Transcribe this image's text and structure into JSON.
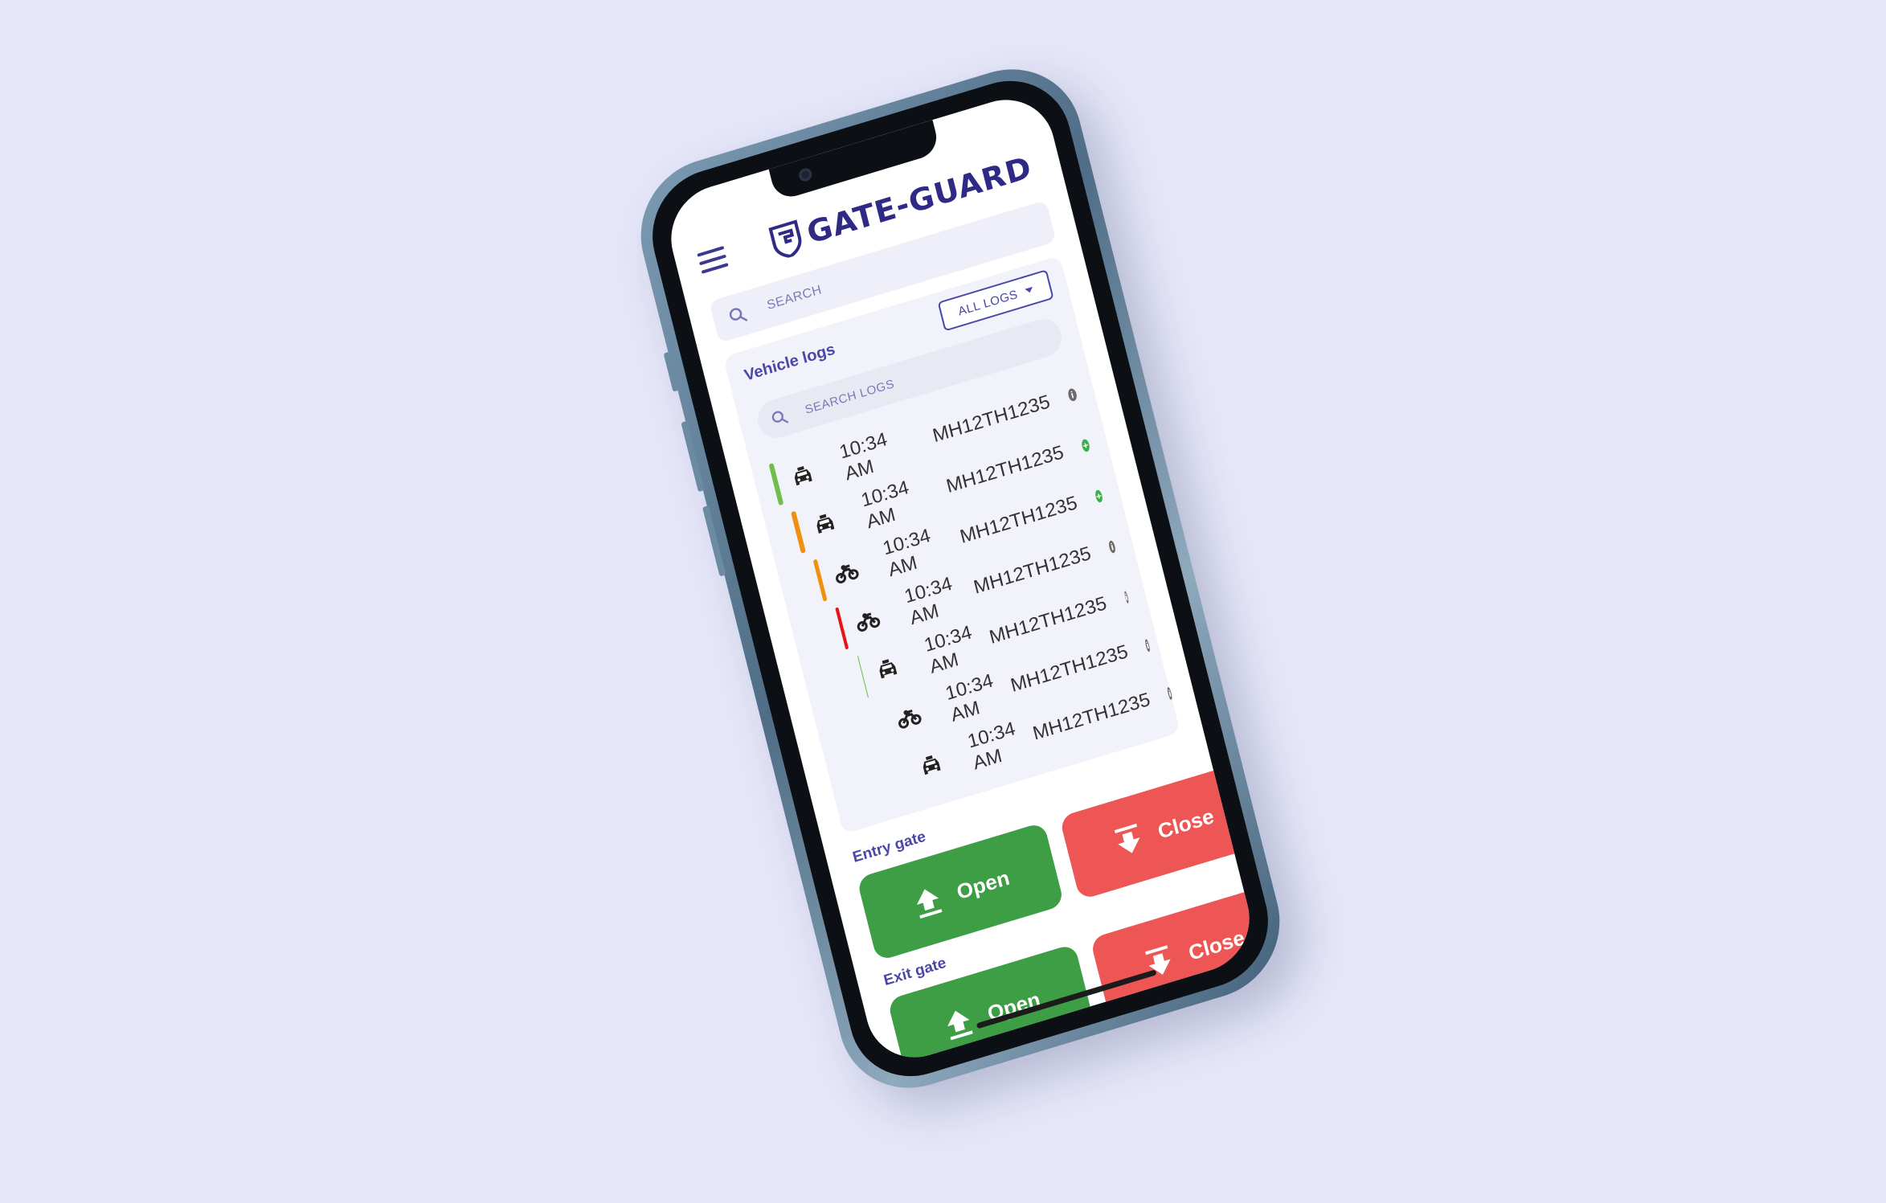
{
  "app": {
    "name": "GATE-GUARD"
  },
  "search": {
    "placeholder": "SEARCH"
  },
  "logs": {
    "title": "Vehicle logs",
    "filter_label": "ALL LOGS",
    "search_placeholder": "SEARCH LOGS",
    "rows": [
      {
        "status_color": "#6FBF4A",
        "vehicle_icon": "car-icon",
        "time": "10:34 AM",
        "plate": "MH12TH1235",
        "badge": "info",
        "badge_color": "#6b6b6b"
      },
      {
        "status_color": "#F0900D",
        "vehicle_icon": "car-icon",
        "time": "10:34 AM",
        "plate": "MH12TH1235",
        "badge": "add",
        "badge_color": "#3BAF4A"
      },
      {
        "status_color": "#F0900D",
        "vehicle_icon": "motorcycle-icon",
        "time": "10:34 AM",
        "plate": "MH12TH1235",
        "badge": "add",
        "badge_color": "#3BAF4A"
      },
      {
        "status_color": "#E81414",
        "vehicle_icon": "motorcycle-icon",
        "time": "10:34 AM",
        "plate": "MH12TH1235",
        "badge": "info",
        "badge_color": "#6b6b6b"
      },
      {
        "status_color": "#6FBF4A",
        "vehicle_icon": "car-icon",
        "time": "10:34 AM",
        "plate": "MH12TH1235",
        "badge": "info",
        "badge_color": "#6b6b6b"
      },
      {
        "status_color": "#4E8FEF",
        "vehicle_icon": "motorcycle-icon",
        "time": "10:34 AM",
        "plate": "MH12TH1235",
        "badge": "info",
        "badge_color": "#6b6b6b"
      },
      {
        "status_color": "#6FBF4A",
        "vehicle_icon": "car-icon",
        "time": "10:34 AM",
        "plate": "MH12TH1235",
        "badge": "info",
        "badge_color": "#6b6b6b"
      }
    ]
  },
  "entry_gate": {
    "label": "Entry gate",
    "open_label": "Open",
    "close_label": "Close"
  },
  "exit_gate": {
    "label": "Exit gate",
    "open_label": "Open",
    "close_label": "Close"
  },
  "colors": {
    "background": "#E6E7FA",
    "brand": "#2f2a86",
    "accent": "#4a47a8",
    "open": "#3E9E46",
    "close": "#EE5656"
  }
}
